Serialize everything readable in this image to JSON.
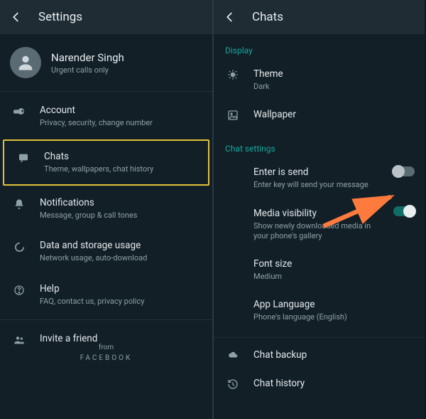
{
  "left": {
    "header": {
      "title": "Settings"
    },
    "profile": {
      "name": "Narender Singh",
      "status": "Urgent calls only"
    },
    "items": [
      {
        "icon": "key",
        "title": "Account",
        "sub": "Privacy, security, change number"
      },
      {
        "icon": "chat",
        "title": "Chats",
        "sub": "Theme, wallpapers, chat history"
      },
      {
        "icon": "bell",
        "title": "Notifications",
        "sub": "Message, group & call tones"
      },
      {
        "icon": "data",
        "title": "Data and storage usage",
        "sub": "Network usage, auto-download"
      },
      {
        "icon": "help",
        "title": "Help",
        "sub": "FAQ, contact us, privacy policy"
      },
      {
        "icon": "people",
        "title": "Invite a friend",
        "sub": ""
      }
    ],
    "footer": {
      "from": "from",
      "brand": "FACEBOOK"
    }
  },
  "right": {
    "header": {
      "title": "Chats"
    },
    "sections": {
      "display_label": "Display",
      "chat_settings_label": "Chat settings"
    },
    "display": [
      {
        "icon": "theme",
        "title": "Theme",
        "sub": "Dark"
      },
      {
        "icon": "wallpaper",
        "title": "Wallpaper",
        "sub": ""
      }
    ],
    "chat_settings": [
      {
        "title": "Enter is send",
        "sub": "Enter key will send your message",
        "toggle": "off"
      },
      {
        "title": "Media visibility",
        "sub": "Show newly downloaded media in your phone's gallery",
        "toggle": "on"
      },
      {
        "title": "Font size",
        "sub": "Medium"
      },
      {
        "title": "App Language",
        "sub": "Phone's language (English)"
      }
    ],
    "bottom": [
      {
        "icon": "cloud",
        "title": "Chat backup"
      },
      {
        "icon": "history",
        "title": "Chat history"
      }
    ]
  },
  "colors": {
    "accent": "#12a89d",
    "highlight": "#e0c23b",
    "arrow": "#ff7a3d"
  }
}
